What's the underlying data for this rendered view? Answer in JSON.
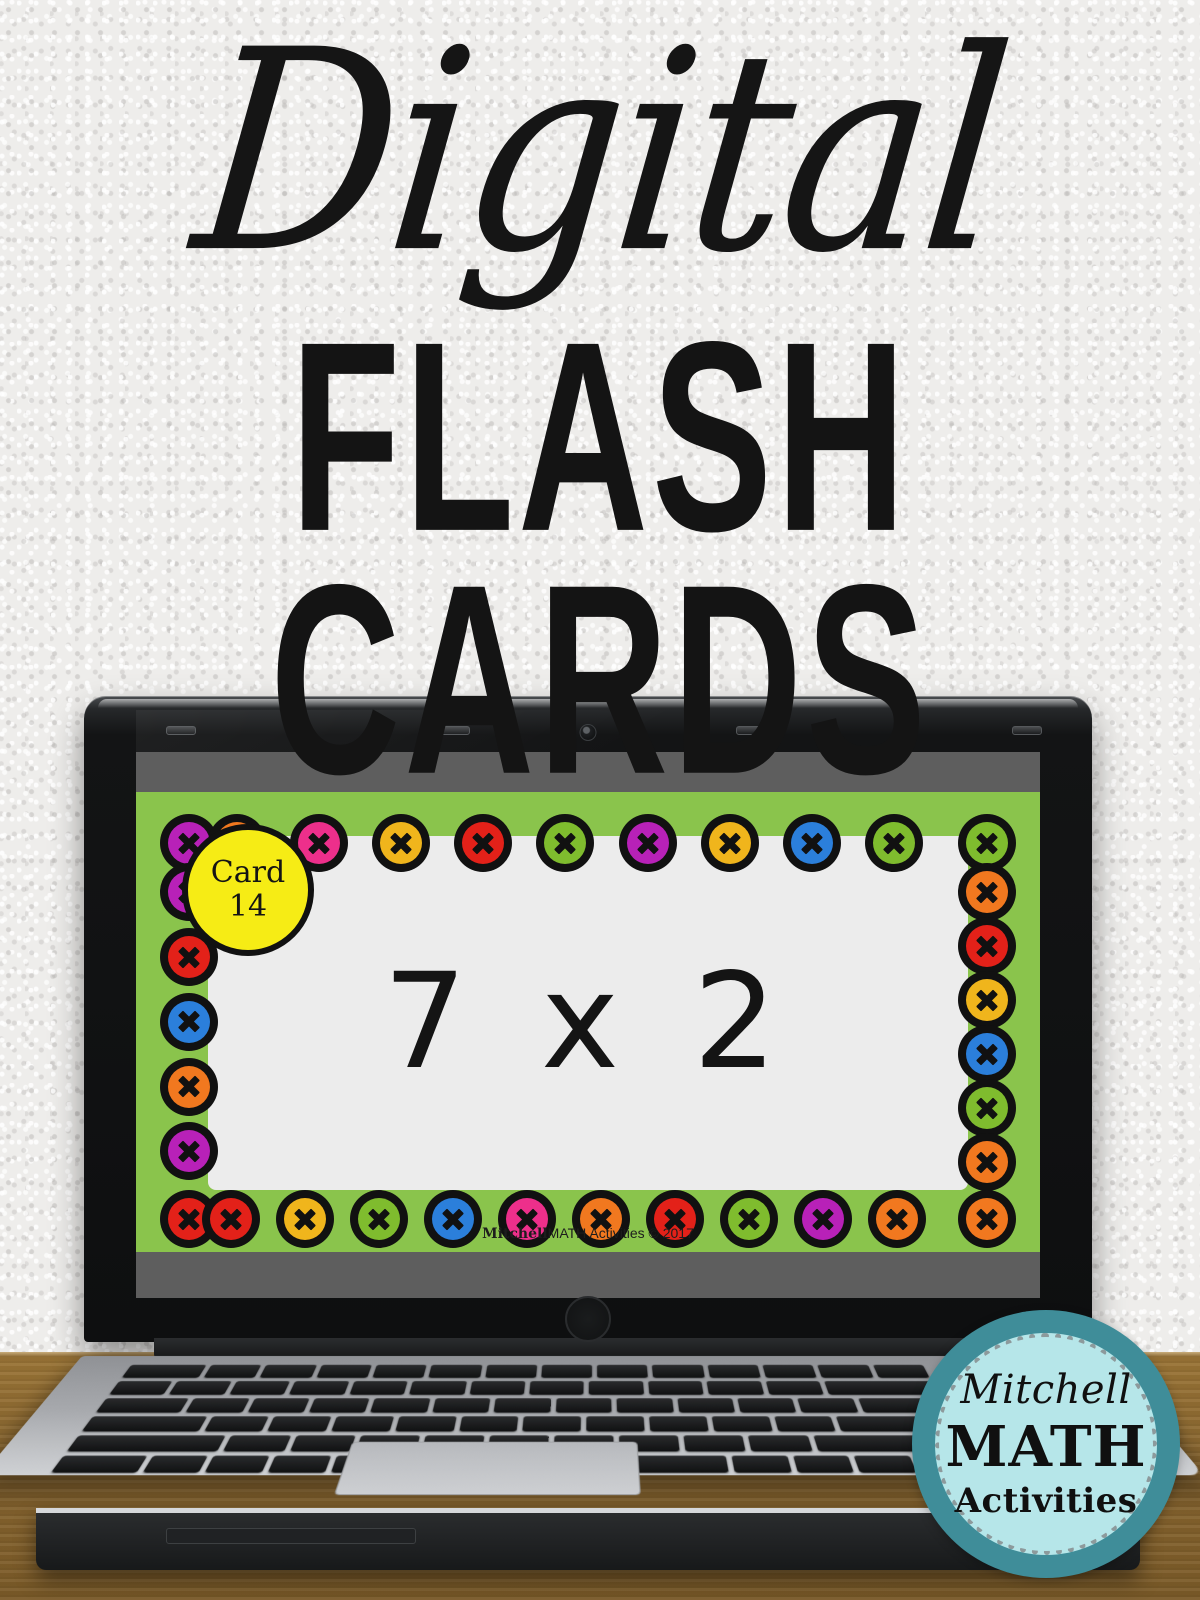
{
  "headline": {
    "line1": "Digital",
    "line2": "FLASH CARDS"
  },
  "slide": {
    "badge": {
      "label": "Card",
      "number": "14"
    },
    "expression": "7 x 2",
    "copyright_brand": "Mitchell",
    "copyright_rest": "MATH Activities © 2017",
    "background_color": "#8ac44c",
    "card_color": "#ececec",
    "screen_bar_color": "#5e5e5e",
    "badge_color": "#f6ec15"
  },
  "border": {
    "top": [
      "#f1781f",
      "#ed2f8b",
      "#f0b51c",
      "#e32119",
      "#7fbc2e",
      "#b821b8",
      "#f0b51c",
      "#2b7fdb",
      "#7fbc2e"
    ],
    "right": [
      "#f1781f",
      "#e32119",
      "#f0b51c",
      "#2b7fdb",
      "#7fbc2e",
      "#f1781f"
    ],
    "bottom": [
      "#e32119",
      "#f0b51c",
      "#7fbc2e",
      "#2b7fdb",
      "#ed2f8b",
      "#f1781f",
      "#e32119",
      "#7fbc2e",
      "#b821b8",
      "#f1781f"
    ],
    "left": [
      "#b821b8",
      "#e32119",
      "#2b7fdb",
      "#f1781f",
      "#b821b8"
    ],
    "corner_tl": "#b821b8",
    "corner_tr": "#7fbc2e",
    "corner_bl": "#e32119",
    "corner_br": "#f1781f",
    "icon": "x-button-icon"
  },
  "logo": {
    "line1": "Mitchell",
    "line2": "MATH",
    "line3": "Activities",
    "ring_color": "#3f8d99",
    "fill_color": "#b6e6e9"
  },
  "scene": {
    "wall_color": "#eeedeb",
    "desk_color": "#8a6730",
    "device": "laptop"
  }
}
